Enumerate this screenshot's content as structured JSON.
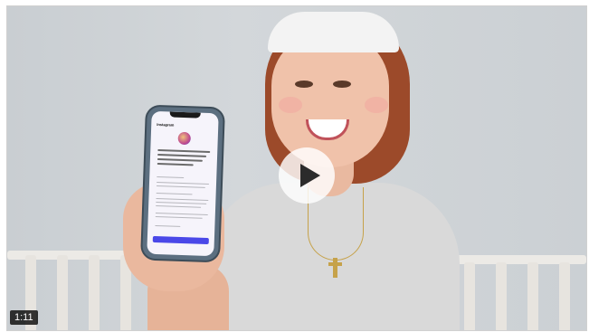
{
  "video": {
    "duration": "1:11",
    "phone_screen": {
      "app_title": "Instagram"
    }
  },
  "colors": {
    "play_button": "#ffffff",
    "duration_bg": "#000000",
    "ig_button": "#4a48e8"
  },
  "icons": {
    "play": "play-icon",
    "app_logo": "instagram-logo-icon"
  }
}
